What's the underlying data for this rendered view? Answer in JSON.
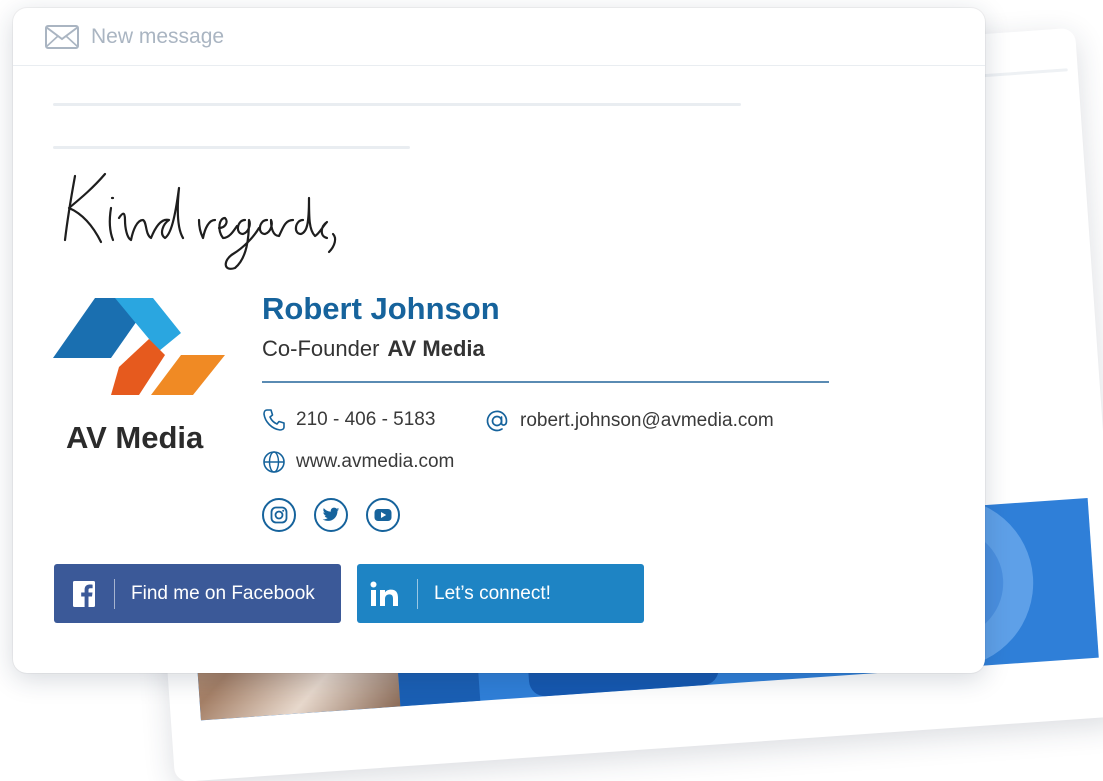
{
  "header": {
    "title": "New message",
    "icon": "envelope-icon"
  },
  "signature": {
    "closing": "Kind regards,",
    "company_logo_text": "AV Media",
    "name": "Robert Johnson",
    "role": "Co-Founder",
    "company": "AV Media",
    "phone": "210 - 406 - 5183",
    "email": "robert.johnson@avmedia.com",
    "website": "www.avmedia.com",
    "socials": [
      "instagram-icon",
      "twitter-icon",
      "youtube-icon"
    ]
  },
  "buttons": {
    "facebook_label": "Find me on Facebook",
    "linkedin_label": "Let’s connect!"
  },
  "colors": {
    "name": "#16639c",
    "facebook": "#3b5998",
    "linkedin": "#1e84c4",
    "logo_blue_dark": "#1a6fb0",
    "logo_blue_light": "#2aa6e0",
    "logo_orange": "#f08a24",
    "logo_orange_dark": "#e65a1e"
  }
}
